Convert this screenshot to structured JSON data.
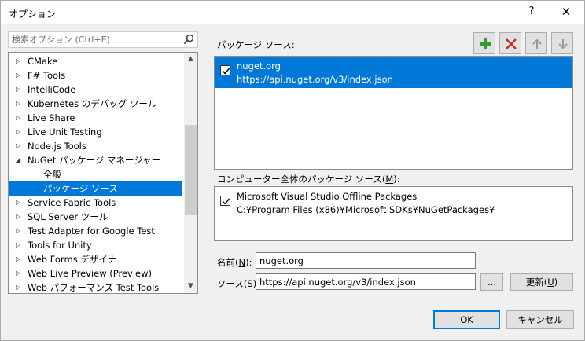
{
  "window": {
    "title": "オプション",
    "help": "?",
    "close": "✕"
  },
  "search": {
    "placeholder": "検索オプション (Ctrl+E)"
  },
  "tree": {
    "items": [
      {
        "label": "CMake",
        "expandable": true
      },
      {
        "label": "F# Tools",
        "expandable": true
      },
      {
        "label": "IntelliCode",
        "expandable": true
      },
      {
        "label": "Kubernetes のデバッグ ツール",
        "expandable": true
      },
      {
        "label": "Live Share",
        "expandable": true
      },
      {
        "label": "Live Unit Testing",
        "expandable": true
      },
      {
        "label": "Node.js Tools",
        "expandable": true
      },
      {
        "label": "NuGet パッケージ マネージャー",
        "expandable": true,
        "expanded": true
      },
      {
        "label": "全般",
        "child": true
      },
      {
        "label": "パッケージ ソース",
        "child": true,
        "selected": true
      },
      {
        "label": "Service Fabric Tools",
        "expandable": true
      },
      {
        "label": "SQL Server ツール",
        "expandable": true
      },
      {
        "label": "Test Adapter for Google Test",
        "expandable": true
      },
      {
        "label": "Tools for Unity",
        "expandable": true
      },
      {
        "label": "Web Forms デザイナー",
        "expandable": true
      },
      {
        "label": "Web Live Preview (Preview)",
        "expandable": true
      },
      {
        "label": "Web パフォーマンス Test Tools",
        "expandable": true
      }
    ]
  },
  "sources": {
    "label": "パッケージ ソース:",
    "items": [
      {
        "name": "nuget.org",
        "url": "https://api.nuget.org/v3/index.json",
        "checked": true
      }
    ]
  },
  "machine_sources": {
    "label_prefix": "コンピューター全体のパッケージ ソース(",
    "label_key": "M",
    "label_suffix": "):",
    "items": [
      {
        "name": "Microsoft Visual Studio Offline Packages",
        "path": "C:¥Program Files (x86)¥Microsoft SDKs¥NuGetPackages¥",
        "checked": true
      }
    ]
  },
  "fields": {
    "name_label_prefix": "名前(",
    "name_label_key": "N",
    "name_label_suffix": "):",
    "name_value": "nuget.org",
    "source_label_prefix": "ソース(",
    "source_label_key": "S",
    "source_label_suffix": "):",
    "source_value": "https://api.nuget.org/v3/index.json",
    "browse_label": "...",
    "update_prefix": "更新(",
    "update_key": "U",
    "update_suffix": ")"
  },
  "footer": {
    "ok": "OK",
    "cancel": "キャンセル"
  },
  "colors": {
    "accent": "#0078d7",
    "add": "#2e9e2e",
    "remove": "#c42b1c"
  }
}
